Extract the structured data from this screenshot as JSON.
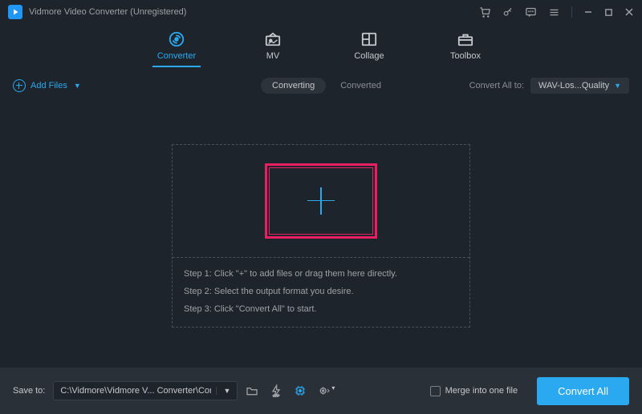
{
  "window": {
    "title": "Vidmore Video Converter (Unregistered)"
  },
  "tabs": [
    {
      "label": "Converter",
      "active": true
    },
    {
      "label": "MV"
    },
    {
      "label": "Collage"
    },
    {
      "label": "Toolbox"
    }
  ],
  "toolbar": {
    "add_files": "Add Files",
    "converting": "Converting",
    "converted": "Converted",
    "convert_all_to": "Convert All to:",
    "format_selected": "WAV-Los...Quality"
  },
  "dropzone": {
    "step1": "Step 1: Click \"+\" to add files or drag them here directly.",
    "step2": "Step 2: Select the output format you desire.",
    "step3": "Step 3: Click \"Convert All\" to start."
  },
  "footer": {
    "save_to_label": "Save to:",
    "save_path": "C:\\Vidmore\\Vidmore V... Converter\\Converted",
    "merge_label": "Merge into one file",
    "convert_all": "Convert All"
  }
}
